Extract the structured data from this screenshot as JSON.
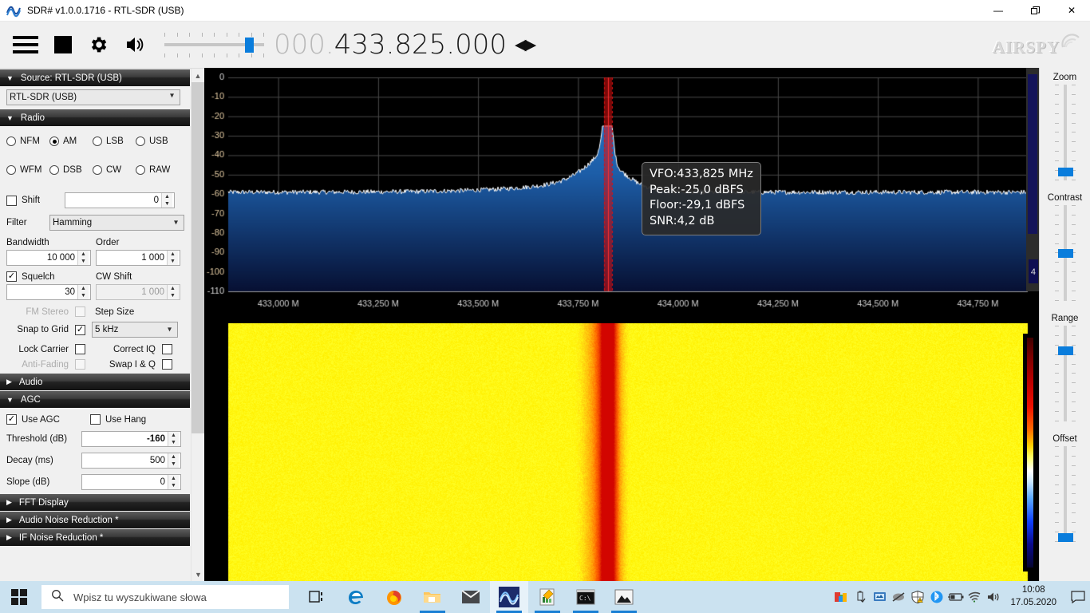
{
  "window": {
    "title": "SDR# v1.0.0.1716 - RTL-SDR (USB)",
    "app_icon": "sdrsharp-icon",
    "minimize": "—",
    "maximize": "❐",
    "close": "✕"
  },
  "toolbar": {
    "menu_icon": "hamburger-menu-icon",
    "stop_icon": "stop-square-icon",
    "settings_icon": "gear-icon",
    "volume_icon": "speaker-icon",
    "volume_value": 81,
    "frequency_dim": "000.",
    "frequency_main": "433.825.000",
    "frequency_arrows": "◀▶",
    "brand": "AIRSPY"
  },
  "sidebar": {
    "source_group": {
      "title": "Source: RTL-SDR (USB)",
      "expanded": true,
      "device_selected": "RTL-SDR (USB)",
      "device_options": [
        "RTL-SDR (USB)"
      ]
    },
    "radio_group": {
      "title": "Radio",
      "expanded": true,
      "modes_row1": [
        {
          "label": "NFM",
          "selected": false
        },
        {
          "label": "AM",
          "selected": true
        },
        {
          "label": "LSB",
          "selected": false
        },
        {
          "label": "USB",
          "selected": false
        }
      ],
      "modes_row2": [
        {
          "label": "WFM",
          "selected": false
        },
        {
          "label": "DSB",
          "selected": false
        },
        {
          "label": "CW",
          "selected": false
        },
        {
          "label": "RAW",
          "selected": false
        }
      ],
      "shift_label": "Shift",
      "shift_checked": false,
      "shift_value": "0",
      "filter_label": "Filter",
      "filter_selected": "Hamming",
      "filter_options": [
        "Hamming"
      ],
      "bandwidth_label": "Bandwidth",
      "bandwidth_value": "10 000",
      "order_label": "Order",
      "order_value": "1 000",
      "squelch_label": "Squelch",
      "squelch_checked": true,
      "squelch_value": "30",
      "cw_shift_label": "CW Shift",
      "cw_shift_value": "1 000",
      "cw_shift_enabled": false,
      "fm_stereo_label": "FM Stereo",
      "fm_stereo_checked": false,
      "fm_stereo_enabled": false,
      "step_size_label": "Step Size",
      "step_size_selected": "5 kHz",
      "step_size_options": [
        "5 kHz"
      ],
      "snap_to_grid_label": "Snap to Grid",
      "snap_to_grid_checked": true,
      "lock_carrier_label": "Lock Carrier",
      "lock_carrier_checked": false,
      "correct_iq_label": "Correct IQ",
      "correct_iq_checked": false,
      "anti_fading_label": "Anti-Fading",
      "anti_fading_checked": false,
      "anti_fading_enabled": false,
      "swap_iq_label": "Swap I & Q",
      "swap_iq_checked": false
    },
    "audio_group": {
      "title": "Audio",
      "expanded": false
    },
    "agc_group": {
      "title": "AGC",
      "expanded": true,
      "use_agc_label": "Use AGC",
      "use_agc_checked": true,
      "use_hang_label": "Use Hang",
      "use_hang_checked": false,
      "threshold_label": "Threshold (dB)",
      "threshold_value": "-160",
      "decay_label": "Decay (ms)",
      "decay_value": "500",
      "slope_label": "Slope (dB)",
      "slope_value": "0"
    },
    "collapsed_groups": [
      {
        "title": "FFT Display"
      },
      {
        "title": "Audio Noise Reduction *"
      },
      {
        "title": "IF Noise Reduction *"
      }
    ],
    "scroll_up_icon": "chevron-up-icon",
    "scroll_down_icon": "chevron-down-icon"
  },
  "spectrum": {
    "tooltip": {
      "vfo": "VFO:433,825 MHz",
      "peak": "Peak:-25,0 dBFS",
      "floor": "Floor:-29,1 dBFS",
      "snr": "SNR:4,2 dB"
    },
    "scroll_number": "4"
  },
  "right_sliders": [
    {
      "label": "Zoom",
      "value": 8
    },
    {
      "label": "Contrast",
      "value": 50
    },
    {
      "label": "Range",
      "value": 76
    },
    {
      "label": "Offset",
      "value": 6
    }
  ],
  "taskbar": {
    "start_icon": "windows-logo-icon",
    "search_icon": "search-icon",
    "search_placeholder": "Wpisz tu wyszukiwane słowa",
    "apps": [
      {
        "name": "task-view-icon",
        "active": false,
        "running": false
      },
      {
        "name": "edge-browser-icon",
        "active": false,
        "running": false
      },
      {
        "name": "firefox-browser-icon",
        "active": false,
        "running": false
      },
      {
        "name": "file-explorer-icon",
        "active": false,
        "running": true
      },
      {
        "name": "mail-icon",
        "active": false,
        "running": false
      },
      {
        "name": "sdrsharp-icon",
        "active": true,
        "running": true
      },
      {
        "name": "notepad-editor-icon",
        "active": false,
        "running": true
      },
      {
        "name": "terminal-icon",
        "active": false,
        "running": true
      },
      {
        "name": "photos-icon",
        "active": false,
        "running": true
      }
    ],
    "tray_icons": [
      "graphics-settings-icon",
      "usb-eject-icon",
      "network-monitor-icon",
      "mouse-disabled-icon",
      "security-warning-icon",
      "bluetooth-icon",
      "battery-icon",
      "wifi-icon",
      "volume-icon"
    ],
    "clock_time": "10:08",
    "clock_date": "17.05.2020",
    "action_center_icon": "notification-icon"
  },
  "chart_data": {
    "type": "line",
    "title": "RF Spectrum",
    "xlabel": "",
    "ylabel": "dBFS",
    "ylim": [
      -110,
      0
    ],
    "yticks": [
      0,
      -10,
      -20,
      -30,
      -40,
      -50,
      -60,
      -70,
      -80,
      -90,
      -100,
      -110
    ],
    "xticks": [
      "433,000 M",
      "433,250 M",
      "433,500 M",
      "433,750 M",
      "434,000 M",
      "434,250 M",
      "434,500 M",
      "434,750 M"
    ],
    "xlim_mhz": [
      432.875,
      434.875
    ],
    "grid": true,
    "legend": "none",
    "noise_floor_dbfs": -59,
    "peak_dbfs": -25,
    "vfo_mhz": 433.825,
    "vfo_marker_color": "#e01010",
    "trace_color": "#ffffff",
    "fill_gradient": [
      "#2e7fd0",
      "#071033"
    ]
  },
  "colors": {
    "accent": "#0a7ddc",
    "taskbar": "#cbe2f0",
    "panel_bg": "#f0f0f0",
    "group_header": "#1f1f1f",
    "spectrum_bg": "#000000"
  }
}
